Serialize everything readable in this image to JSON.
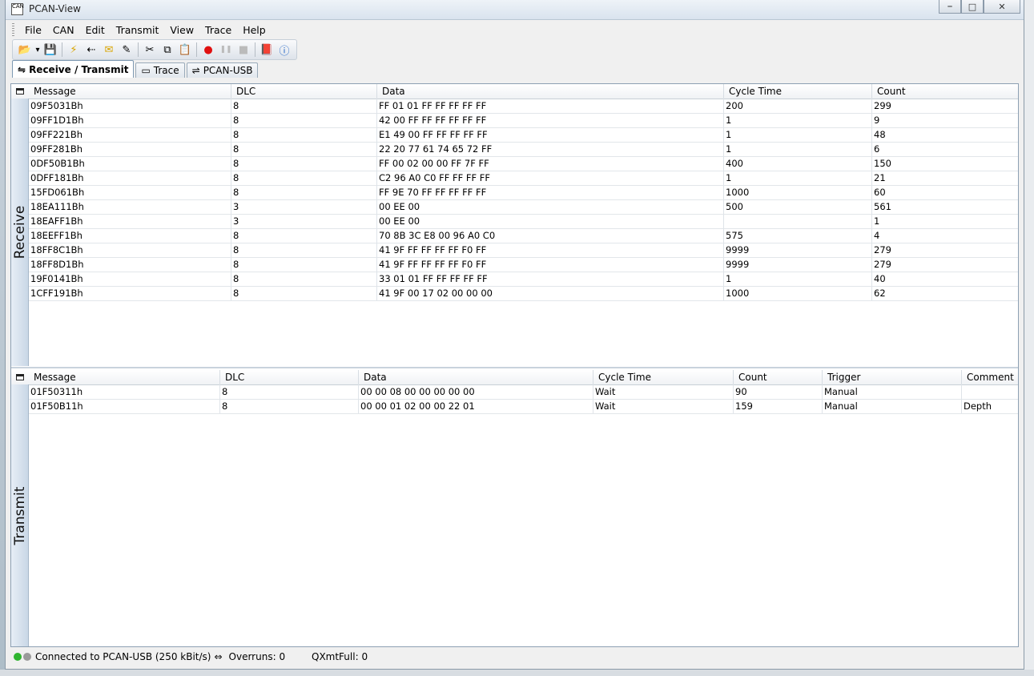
{
  "window": {
    "title": "PCAN-View",
    "icon_text": "CAN"
  },
  "menu": [
    "File",
    "CAN",
    "Edit",
    "Transmit",
    "View",
    "Trace",
    "Help"
  ],
  "toolbar": {
    "icons": [
      "open-folder-icon",
      "dropdown-arrow-icon",
      "save-icon",
      "sep",
      "connect-icon",
      "disconnect-icon",
      "new-message-icon",
      "edit-message-icon",
      "sep",
      "cut-icon",
      "copy-icon",
      "paste-icon",
      "sep",
      "record-icon",
      "pause-icon",
      "stop-icon",
      "sep",
      "help-book-icon",
      "info-icon"
    ]
  },
  "tabs": [
    {
      "label": "Receive / Transmit",
      "active": true
    },
    {
      "label": "Trace",
      "active": false
    },
    {
      "label": "PCAN-USB",
      "active": false
    }
  ],
  "receive": {
    "side_label": "Receive",
    "columns": [
      "Message",
      "DLC",
      "Data",
      "Cycle Time",
      "Count"
    ],
    "rows": [
      [
        "09F5031Bh",
        "8",
        "FF 01 01 FF FF FF FF FF",
        "200",
        "299"
      ],
      [
        "09FF1D1Bh",
        "8",
        "42 00 FF FF FF FF FF FF",
        "1",
        "9"
      ],
      [
        "09FF221Bh",
        "8",
        "E1 49 00 FF FF FF FF FF",
        "1",
        "48"
      ],
      [
        "09FF281Bh",
        "8",
        "22 20 77 61 74 65 72 FF",
        "1",
        "6"
      ],
      [
        "0DF50B1Bh",
        "8",
        "FF 00 02 00 00 FF 7F FF",
        "400",
        "150"
      ],
      [
        "0DFF181Bh",
        "8",
        "C2 96 A0 C0 FF FF FF FF",
        "1",
        "21"
      ],
      [
        "15FD061Bh",
        "8",
        "FF 9E 70 FF FF FF FF FF",
        "1000",
        "60"
      ],
      [
        "18EA111Bh",
        "3",
        "00 EE 00",
        "500",
        "561"
      ],
      [
        "18EAFF1Bh",
        "3",
        "00 EE 00",
        "",
        "1"
      ],
      [
        "18EEFF1Bh",
        "8",
        "70 8B 3C E8 00 96 A0 C0",
        "575",
        "4"
      ],
      [
        "18FF8C1Bh",
        "8",
        "41 9F FF FF FF FF F0 FF",
        "9999",
        "279"
      ],
      [
        "18FF8D1Bh",
        "8",
        "41 9F FF FF FF FF F0 FF",
        "9999",
        "279"
      ],
      [
        "19F0141Bh",
        "8",
        "33 01 01 FF FF FF FF FF",
        "1",
        "40"
      ],
      [
        "1CFF191Bh",
        "8",
        "41 9F 00 17 02 00 00 00",
        "1000",
        "62"
      ]
    ]
  },
  "transmit": {
    "side_label": "Transmit",
    "columns": [
      "Message",
      "DLC",
      "Data",
      "Cycle Time",
      "Count",
      "Trigger",
      "Comment"
    ],
    "rows": [
      [
        "01F50311h",
        "8",
        "00 00 08 00 00 00 00 00",
        "Wait",
        "90",
        "Manual",
        ""
      ],
      [
        "01F50B11h",
        "8",
        "00 00 01 02 00 00 22 01",
        "Wait",
        "159",
        "Manual",
        "Depth"
      ]
    ]
  },
  "status": {
    "connection": "Connected to PCAN-USB (250 kBit/s)",
    "overruns": "Overruns: 0",
    "qxmtfull": "QXmtFull: 0",
    "led_on_color": "#2fb52f",
    "led_off_color": "#9a9a9a"
  }
}
